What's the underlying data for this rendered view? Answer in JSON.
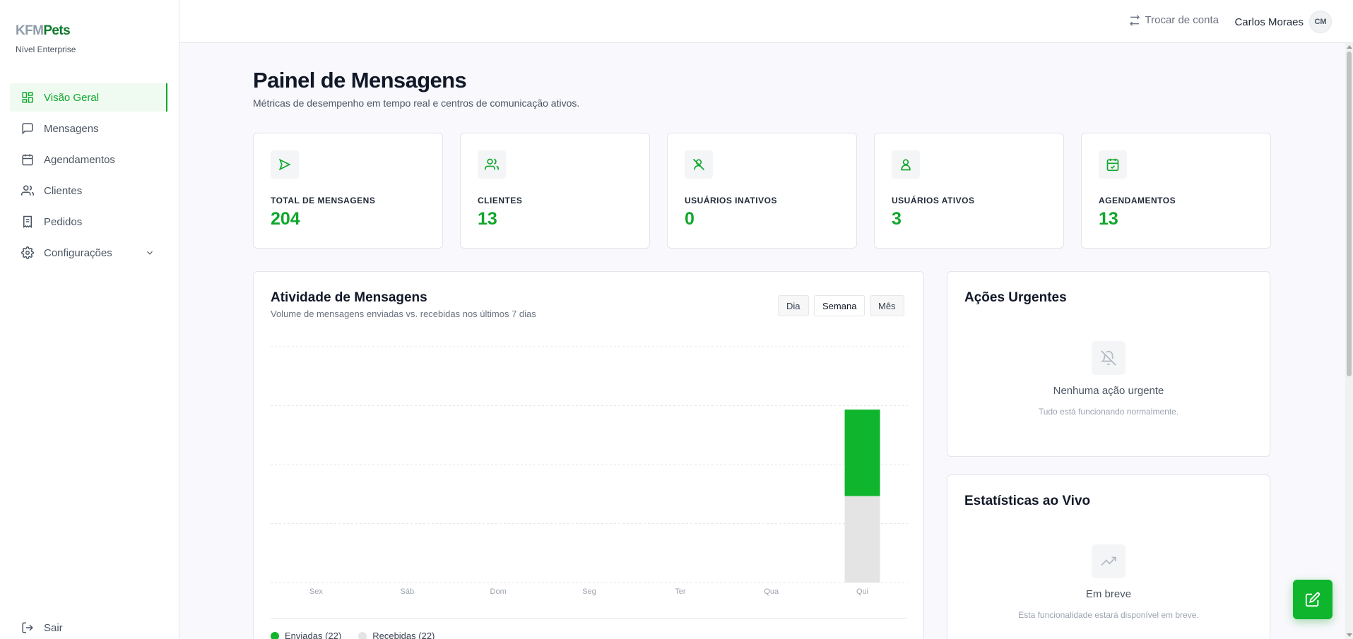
{
  "brand": {
    "part1": "KFM",
    "part2": "Pets",
    "tier": "Nível Enterprise"
  },
  "sidebar": {
    "items": [
      {
        "label": "Visão Geral",
        "icon": "dashboard-icon",
        "active": true
      },
      {
        "label": "Mensagens",
        "icon": "message-icon"
      },
      {
        "label": "Agendamentos",
        "icon": "calendar-icon"
      },
      {
        "label": "Clientes",
        "icon": "users-icon"
      },
      {
        "label": "Pedidos",
        "icon": "receipt-icon"
      },
      {
        "label": "Configurações",
        "icon": "gear-icon",
        "expandable": true
      }
    ],
    "logout_label": "Sair"
  },
  "header": {
    "switch_label": "Trocar de conta",
    "user_name": "Carlos Moraes",
    "user_initials": "CM"
  },
  "page": {
    "title": "Painel de Mensagens",
    "subtitle": "Métricas de desempenho em tempo real e centros de comunicação ativos."
  },
  "stats": [
    {
      "label": "TOTAL DE MENSAGENS",
      "value": "204",
      "icon": "send-icon"
    },
    {
      "label": "CLIENTES",
      "value": "13",
      "icon": "users-icon"
    },
    {
      "label": "USUÁRIOS INATIVOS",
      "value": "0",
      "icon": "user-off-icon"
    },
    {
      "label": "USUÁRIOS ATIVOS",
      "value": "3",
      "icon": "user-icon"
    },
    {
      "label": "AGENDAMENTOS",
      "value": "13",
      "icon": "calendar-check-icon"
    }
  ],
  "activity": {
    "title": "Atividade de Mensagens",
    "subtitle": "Volume de mensagens enviadas vs. recebidas nos últimos 7 dias",
    "periods": [
      "Dia",
      "Semana",
      "Mês"
    ],
    "selected_period": "Semana"
  },
  "chart_data": {
    "type": "bar",
    "stacked": true,
    "categories": [
      "Sex",
      "Sáb",
      "Dom",
      "Seg",
      "Ter",
      "Qua",
      "Qui"
    ],
    "series": [
      {
        "name": "Enviadas (22)",
        "values": [
          0,
          0,
          0,
          0,
          0,
          0,
          22
        ],
        "color": "#10b52e"
      },
      {
        "name": "Recebidas (22)",
        "values": [
          0,
          0,
          0,
          0,
          0,
          0,
          22
        ],
        "color": "#e4e4e4"
      }
    ],
    "ylim": [
      0,
      60
    ],
    "grid": true,
    "legend": "bottom-left"
  },
  "urgent": {
    "title": "Ações Urgentes",
    "empty_title": "Nenhuma ação urgente",
    "empty_sub": "Tudo está funcionando normalmente.",
    "icon": "bell-off-icon"
  },
  "live": {
    "title": "Estatísticas ao Vivo",
    "empty_title": "Em breve",
    "empty_sub": "Esta funcionalidade estará disponível em breve.",
    "icon": "trending-icon"
  },
  "colors": {
    "accent": "#10b52e",
    "accent_text": "#10a72c"
  }
}
